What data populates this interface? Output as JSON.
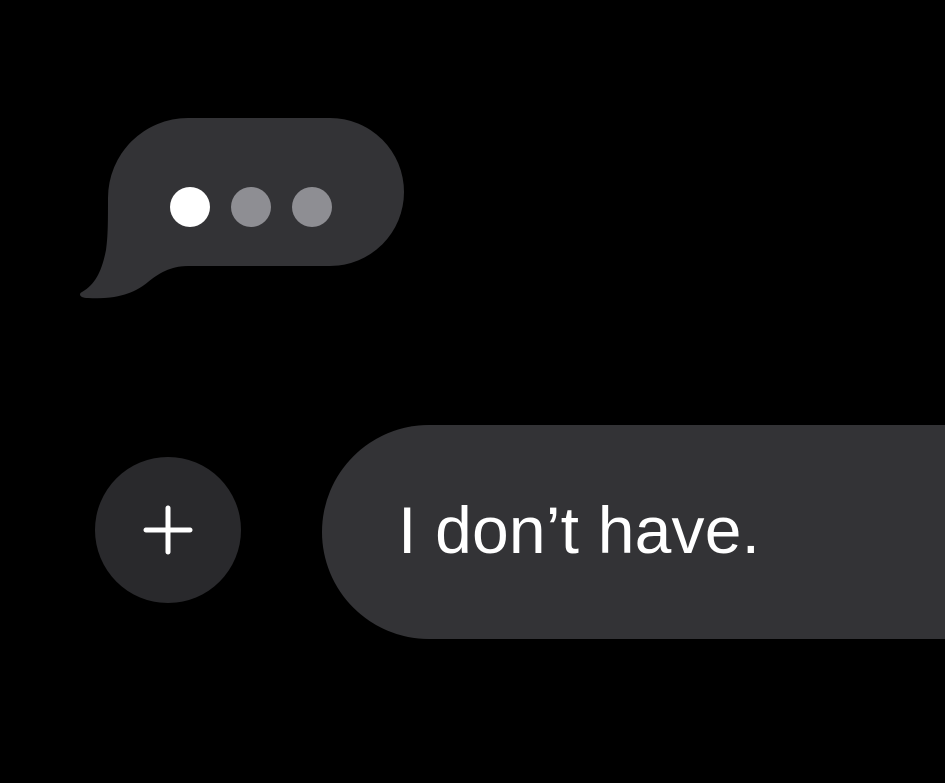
{
  "colors": {
    "background": "#000000",
    "bubble": "#333336",
    "dot_active": "#ffffff",
    "dot_inactive": "#8e8e93",
    "text": "#ffffff",
    "plus_button_bg": "#29292c",
    "field_bg": "#333336"
  },
  "typing_indicator": {
    "dots": [
      {
        "name": "typing-dot-1",
        "state": "active"
      },
      {
        "name": "typing-dot-2",
        "state": "inactive"
      },
      {
        "name": "typing-dot-3",
        "state": "inactive"
      }
    ]
  },
  "composer": {
    "plus_icon": "plus-icon",
    "message_text": "I don’t have."
  }
}
